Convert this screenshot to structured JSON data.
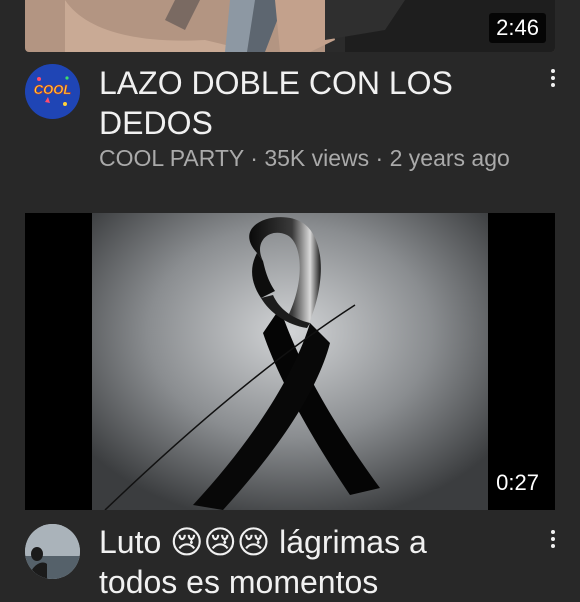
{
  "videos": [
    {
      "duration": "2:46",
      "title": "LAZO DOBLE CON LOS DEDOS",
      "channel": "COOL PARTY",
      "views": "35K views",
      "age": "2 years ago",
      "avatar_text": "COOL",
      "avatar_colors": {
        "bg": "#1f45b5",
        "text": "#ffd23a"
      }
    },
    {
      "duration": "0:27",
      "title_word": "Luto",
      "title_emojis": "😢😢😢",
      "title_rest": "lágrimas a",
      "title_line2": "todos es momentos"
    }
  ],
  "separator": "·",
  "colors": {
    "background": "#282828",
    "primary_text": "#f1f1f1",
    "secondary_text": "#aaaaaa",
    "duration_badge": "#000000"
  }
}
